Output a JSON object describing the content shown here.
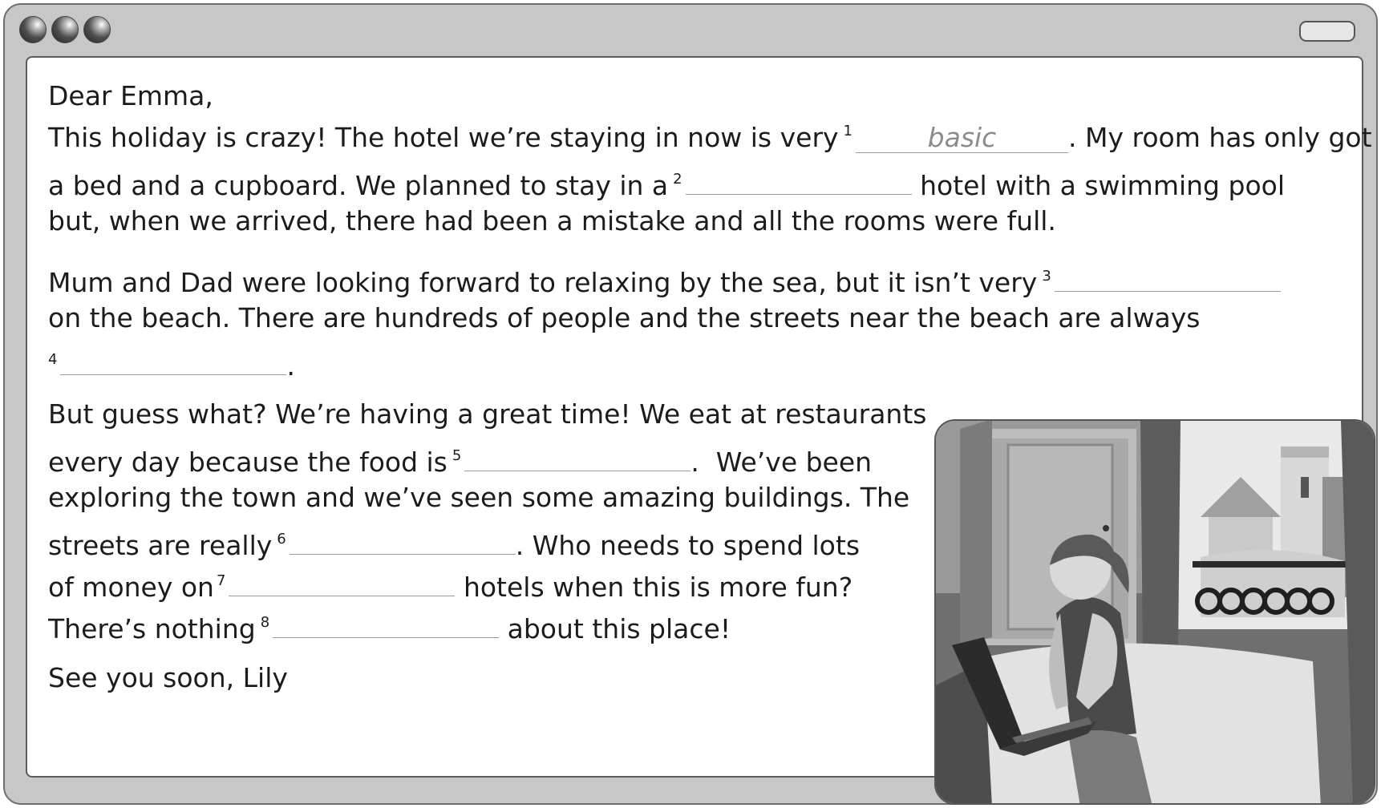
{
  "window": {
    "buttons": [
      "close-dot",
      "minimize-dot",
      "maximize-dot"
    ]
  },
  "letter": {
    "greeting": "Dear Emma,",
    "p1": {
      "l1a": "This holiday is crazy! The hotel we’re staying in now is very",
      "n1": "1",
      "a1": "basic",
      "l1b": ". My room has only got",
      "l2a": "a bed and a cupboard. We planned to stay in a",
      "n2": "2",
      "l2b": "hotel with a swimming pool",
      "l3": "but, when we arrived, there had been a mistake and all the rooms were full."
    },
    "p2": {
      "l1a": "Mum and Dad were looking forward to relaxing by the sea, but it isn’t very",
      "n3": "3",
      "l2": "on the beach. There are hundreds of people and the streets near the beach are always",
      "n4": "4",
      "l3b": "."
    },
    "p3": {
      "l1": "But guess what? We’re having a great time! We eat at restaurants",
      "l2a": "every day because the food is",
      "n5": "5",
      "l2b": ".  We’ve been",
      "l3": "exploring the town and we’ve seen some amazing buildings. The",
      "l4a": "streets are really",
      "n6": "6",
      "l4b": ". Who needs to spend lots",
      "l5a": "of money on",
      "n7": "7",
      "l5b": "hotels when this is more fun?",
      "l6a": "There’s nothing",
      "n8": "8",
      "l6b": "about this place!"
    },
    "closing": "See you soon, Lily"
  },
  "colors": {
    "frame": "#c7c7c7",
    "border": "#5c5c5c",
    "text": "#1c1c1c",
    "answer": "#8c8c8c"
  }
}
